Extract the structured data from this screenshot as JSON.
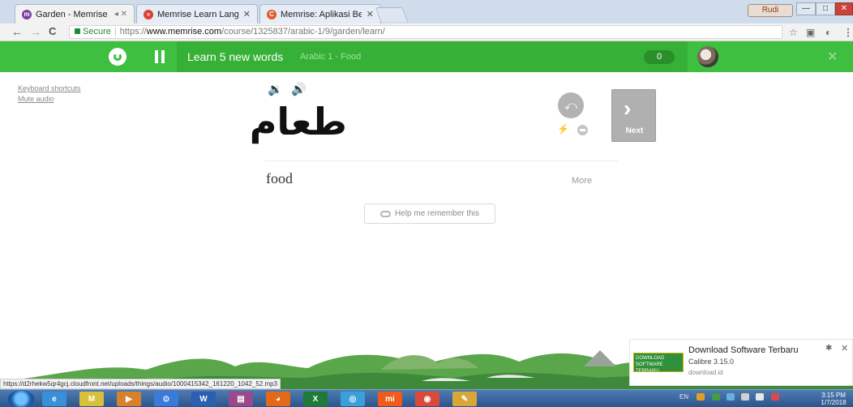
{
  "browser": {
    "tabs": [
      {
        "title": "Garden - Memrise",
        "extra": "◂ ✕",
        "close": "✕",
        "favicon_color": "#7e3fa0"
      },
      {
        "title": "Memrise Learn Language",
        "close": "✕",
        "favicon_color": "#e0402e"
      },
      {
        "title": "Memrise: Aplikasi Belajar",
        "close": "✕",
        "favicon_color": "#e05a2b"
      }
    ],
    "profile_label": "Rudi",
    "window_controls": {
      "minimize": "—",
      "maximize": "□",
      "close": "✕"
    },
    "nav": {
      "back": "←",
      "forward": "→",
      "reload": "C"
    },
    "address": {
      "secure_label": "Secure",
      "scheme": "https://",
      "host": "www.memrise.com",
      "path": "/course/1325837/arabic-1/9/garden/learn/"
    },
    "toolbar_icons": [
      "star-icon",
      "extension-icon",
      "extension-icon",
      "menu-icon"
    ],
    "toolbar_glyphs": {
      "star": "☆",
      "ext1": "▣",
      "ext2": "◐",
      "menu": "⋮"
    }
  },
  "memrise_bar": {
    "title": "Learn 5 new words",
    "subtitle": "Arabic 1 - Food",
    "score": "0",
    "close": "✕"
  },
  "sidebar": {
    "keyboard_shortcuts": "Keyboard shortcuts",
    "mute_audio": "Mute audio"
  },
  "card": {
    "speaker_slow": "🔉",
    "speaker_normal": "🔊",
    "word": "طعام",
    "meaning": "food",
    "more": "More",
    "ignore_icon": "⤺",
    "bolt": "⚡",
    "next_chevron": "›",
    "next_label": "Next",
    "help_label": "Help me remember this"
  },
  "ad": {
    "image_text": "DOWNLOAD SOFTWARE TERBARU",
    "title": "Download Software Terbaru",
    "line2": "Calibre 3.15.0",
    "line3": "download.id",
    "gear": "✱",
    "close": "✕"
  },
  "status_url": "https://d2rhekw5qr4gcj.cloudfront.net/uploads/things/audio/1000415342_161220_1042_52.mp3",
  "taskbar": {
    "apps": [
      {
        "name": "ie",
        "label": "e",
        "color": "#3a8fd9"
      },
      {
        "name": "memrise-m",
        "label": "M",
        "color": "#d9c03a"
      },
      {
        "name": "media",
        "label": "▶",
        "color": "#d9802a"
      },
      {
        "name": "explorer",
        "label": "⊙",
        "color": "#3a7bd9"
      },
      {
        "name": "word",
        "label": "W",
        "color": "#2b5faf"
      },
      {
        "name": "winrar",
        "label": "▤",
        "color": "#9a4a8a"
      },
      {
        "name": "firefox",
        "label": "◕",
        "color": "#e26a1a"
      },
      {
        "name": "excel",
        "label": "X",
        "color": "#1f7a3a"
      },
      {
        "name": "search",
        "label": "◎",
        "color": "#3aa0d9"
      },
      {
        "name": "xiaomi",
        "label": "mi",
        "color": "#f05a1a"
      },
      {
        "name": "chrome",
        "label": "◉",
        "color": "#d94a3a"
      },
      {
        "name": "paint",
        "label": "✎",
        "color": "#d9a63a"
      }
    ],
    "language": "EN",
    "time": "3:15 PM",
    "date": "1/7/2018"
  },
  "colors": {
    "memrise_green": "#3fbf3f",
    "speaker_active": "#2b8ad4",
    "next_button": "#b0b0b0"
  }
}
